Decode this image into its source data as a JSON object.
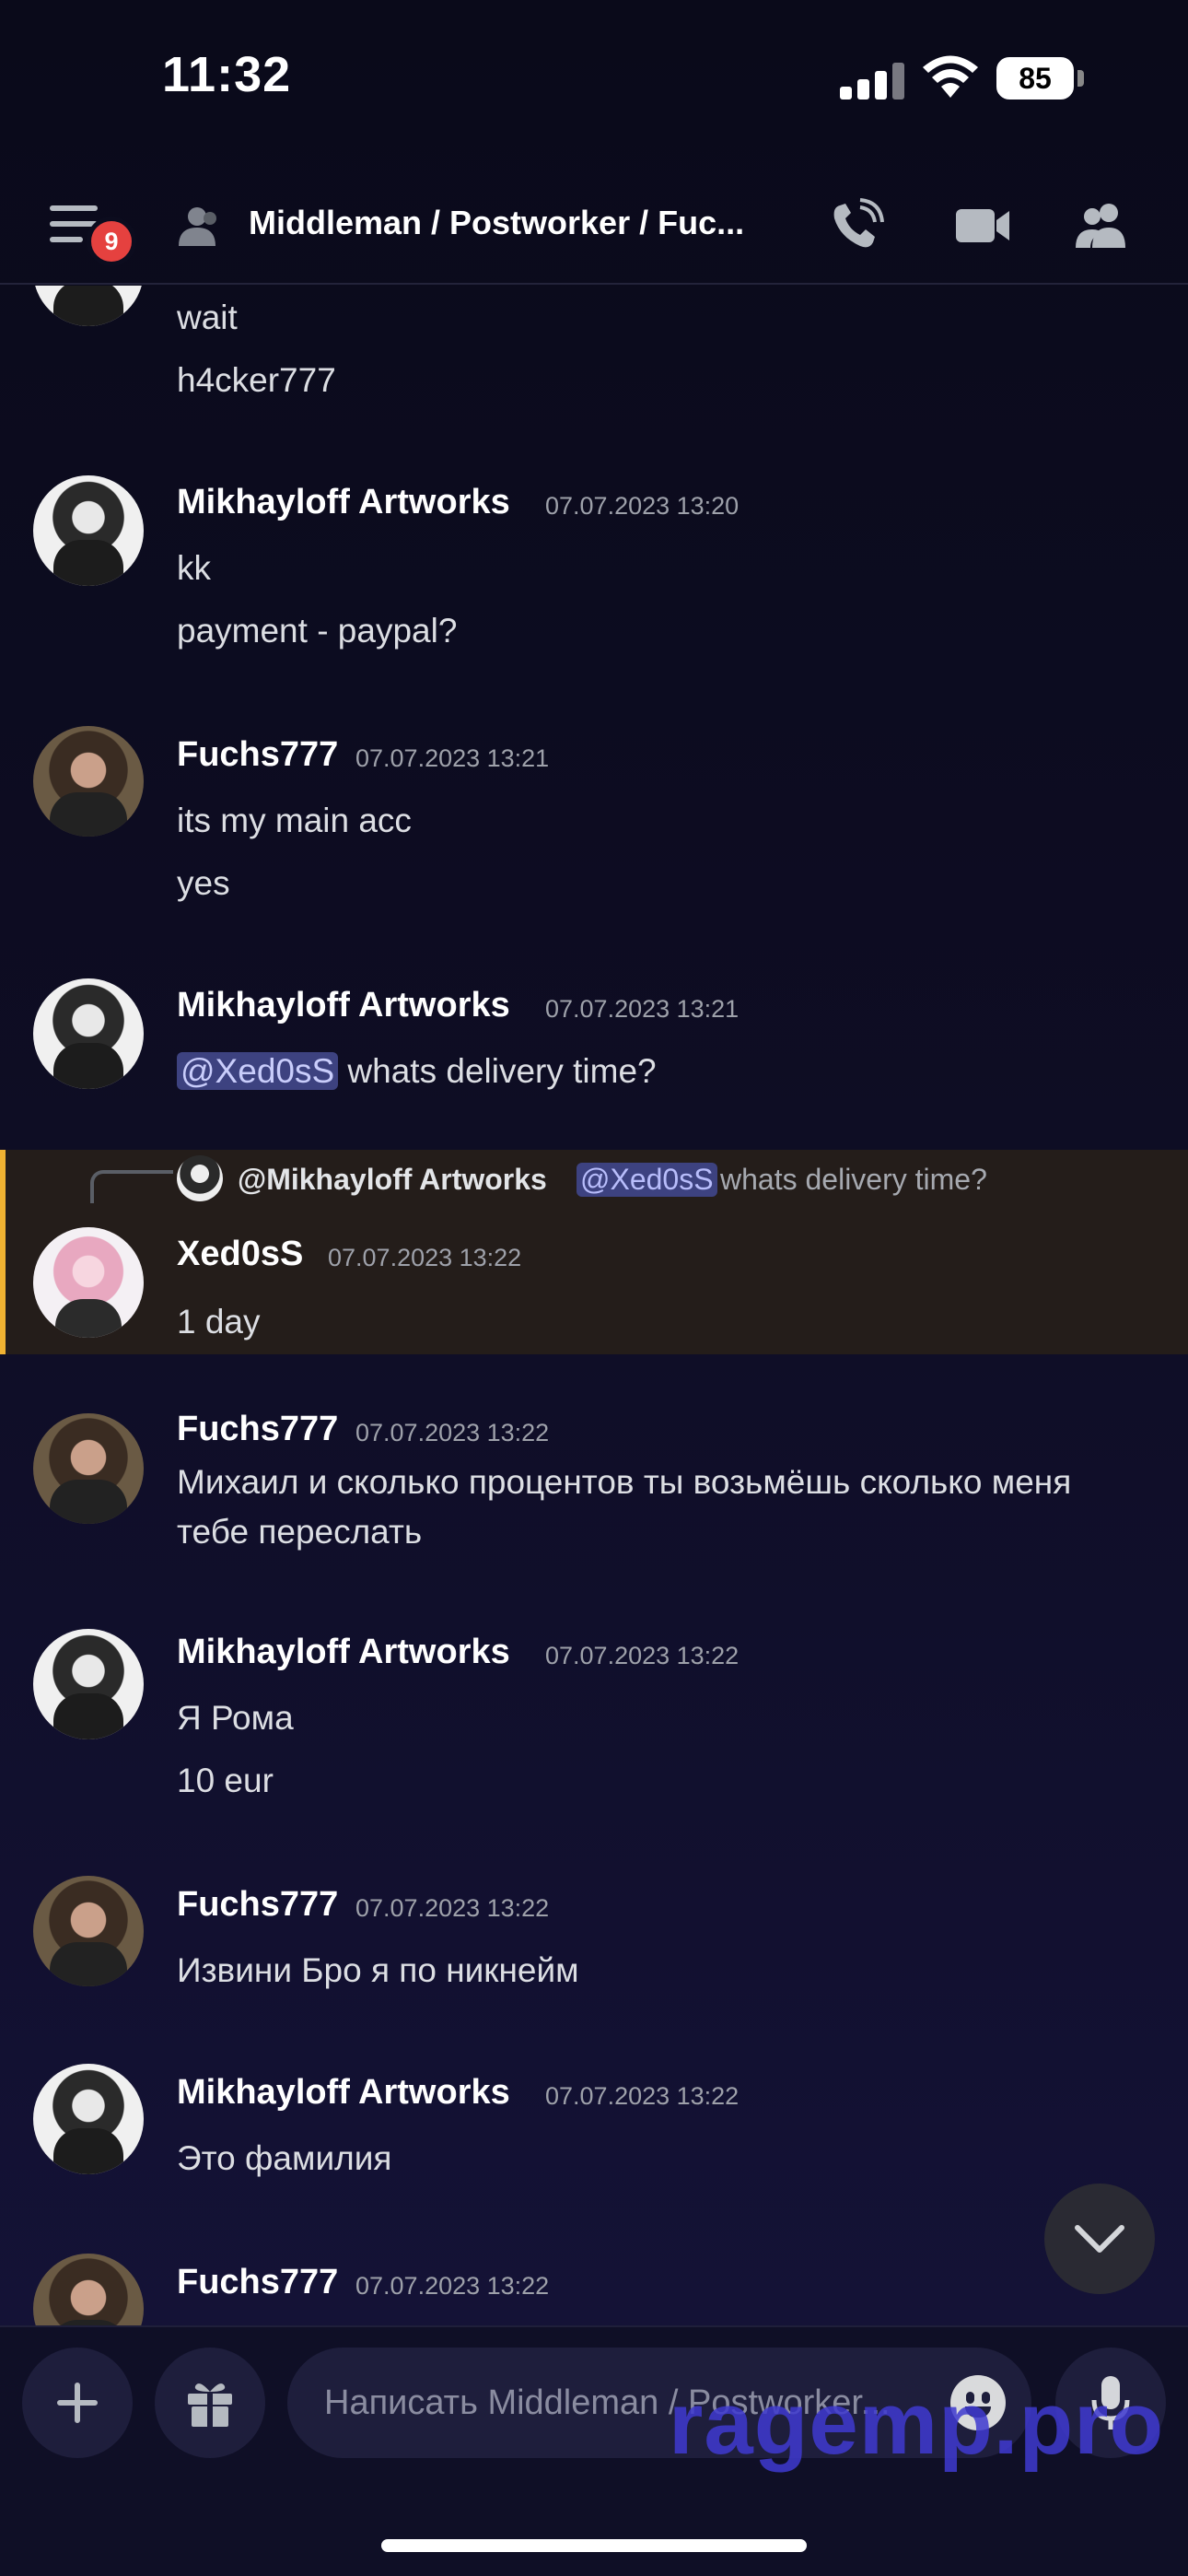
{
  "status_bar": {
    "time": "11:32",
    "battery": "85"
  },
  "header": {
    "badge": "9",
    "title": "Middleman / Postworker / Fuc..."
  },
  "messages": {
    "m0": {
      "lines": [
        "wait",
        "h4cker777"
      ]
    },
    "m1": {
      "user": "Mikhayloff Artworks",
      "time": "07.07.2023 13:20",
      "lines": [
        "kk",
        "payment - paypal?"
      ]
    },
    "m2": {
      "user": "Fuchs777",
      "time": "07.07.2023 13:21",
      "lines": [
        "its my main acc",
        "yes"
      ]
    },
    "m3": {
      "user": "Mikhayloff Artworks",
      "time": "07.07.2023 13:21",
      "mention": "@Xed0sS",
      "text": " whats delivery time?"
    },
    "m4": {
      "reply": {
        "user": "@Mikhayloff Artworks",
        "mention": "@Xed0sS",
        "text": "whats delivery time?"
      },
      "user": "Xed0sS",
      "time": "07.07.2023 13:22",
      "lines": [
        "1 day"
      ]
    },
    "m5": {
      "user": "Fuchs777",
      "time": "07.07.2023 13:22",
      "lines": [
        "Михаил и сколько процентов ты возьмёшь сколько меня",
        "тебе переслать"
      ]
    },
    "m6": {
      "user": "Mikhayloff Artworks",
      "time": "07.07.2023 13:22",
      "lines": [
        "Я Рома",
        "10 eur"
      ]
    },
    "m7": {
      "user": "Fuchs777",
      "time": "07.07.2023 13:22",
      "lines": [
        "Извини Бро я по никнейм"
      ]
    },
    "m8": {
      "user": "Mikhayloff Artworks",
      "time": "07.07.2023 13:22",
      "lines": [
        "Это фамилия"
      ]
    },
    "m9": {
      "user": "Fuchs777",
      "time": "07.07.2023 13:22"
    }
  },
  "composer": {
    "placeholder": "Написать Middleman / Postworker..."
  },
  "watermark": "ragemp.pro",
  "icons": {
    "menu": "hamburger-icon",
    "group": "group-dm-icon",
    "call": "phone-call-icon",
    "video": "video-camera-icon",
    "members": "members-icon",
    "scroll": "chevron-down-icon",
    "plus": "plus-icon",
    "gift": "gift-icon",
    "emoji": "emoji-icon",
    "mic": "microphone-icon"
  },
  "colors": {
    "badge": "#e5413f",
    "highlight_border": "#f0b232",
    "mention_bg": "#3d4280"
  }
}
